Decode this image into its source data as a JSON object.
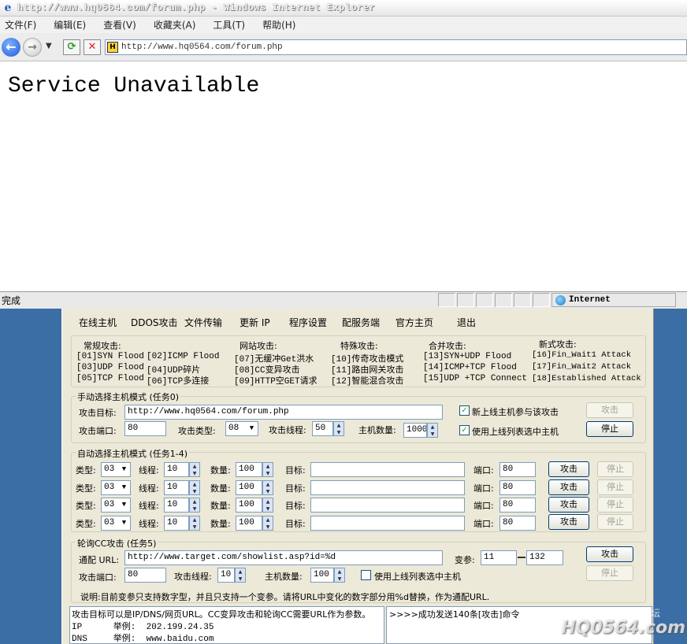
{
  "browser": {
    "title": "http://www.hq0564.com/forum.php - Windows Internet Explorer",
    "menu": [
      "文件(F)",
      "编辑(E)",
      "查看(V)",
      "收藏夹(A)",
      "工具(T)",
      "帮助(H)"
    ],
    "address": "http://www.hq0564.com/forum.php",
    "page_heading": "Service Unavailable",
    "status": "完成",
    "zone": "Internet"
  },
  "app": {
    "toolbar": [
      "在线主机",
      "DDOS攻击",
      "文件传输",
      "更新 IP",
      "程序设置",
      "配服务端",
      "官方主页",
      "退出"
    ],
    "attack_types": {
      "headers": [
        "常规攻击:",
        "网站攻击:",
        "特殊攻击:",
        "合并攻击:",
        "新式攻击:"
      ],
      "col1": [
        "[01]SYN Flood",
        "[03]UDP Flood",
        "[05]TCP Flood"
      ],
      "col2": [
        "[02]ICMP Flood",
        "[04]UDP碎片",
        "[06]TCP多连接"
      ],
      "col3": [
        "[07]无缓冲Get洪水",
        "[08]CC变异攻击",
        "[09]HTTP空GET请求"
      ],
      "col4": [
        "[10]传奇攻击模式",
        "[11]路由网关攻击",
        "[12]智能混合攻击"
      ],
      "col5": [
        "[13]SYN+UDP Flood",
        "[14]ICMP+TCP Flood",
        "[15]UDP +TCP Connect"
      ],
      "col6": [
        "[16]Fin_Wait1 Attack",
        "[17]Fin_Wait2 Attack",
        "[18]Established Attack"
      ]
    },
    "manual": {
      "title": "手动选择主机模式 (任务0)",
      "target_label": "攻击目标:",
      "target_value": "http://www.hq0564.com/forum.php",
      "port_label": "攻击端口:",
      "port_value": "80",
      "type_label": "攻击类型:",
      "type_value": "08",
      "threads_label": "攻击线程:",
      "threads_value": "50",
      "hosts_label": "主机数量:",
      "hosts_value": "1000",
      "chk_new": "新上线主机参与该攻击",
      "chk_list": "使用上线列表选中主机",
      "btn_attack": "攻击",
      "btn_stop": "停止"
    },
    "auto": {
      "title": "自动选择主机模式 (任务1-4)",
      "type_label": "类型:",
      "threads_label": "线程:",
      "count_label": "数量:",
      "target_label": "目标:",
      "port_label": "端口:",
      "btn_attack": "攻击",
      "btn_stop": "停止",
      "rows": [
        {
          "type": "03",
          "threads": "10",
          "count": "100",
          "target": "",
          "port": "80"
        },
        {
          "type": "03",
          "threads": "10",
          "count": "100",
          "target": "",
          "port": "80"
        },
        {
          "type": "03",
          "threads": "10",
          "count": "100",
          "target": "",
          "port": "80"
        },
        {
          "type": "03",
          "threads": "10",
          "count": "100",
          "target": "",
          "port": "80"
        }
      ]
    },
    "poll": {
      "title": "轮询CC攻击 (任务5)",
      "url_label": "通配 URL:",
      "url_value": "http://www.target.com/showlist.asp?id=%d",
      "var_label": "变参:",
      "var_from": "11",
      "var_to": "132",
      "port_label": "攻击端口:",
      "port_value": "80",
      "threads_label": "攻击线程:",
      "threads_value": "10",
      "hosts_label": "主机数量:",
      "hosts_value": "100",
      "chk_list": "使用上线列表选中主机",
      "btn_attack": "攻击",
      "btn_stop": "停止",
      "note": "说明:目前变参只支持数字型，并且只支持一个变参。请将URL中变化的数字部分用%d替换，作为通配URL."
    },
    "log_left": [
      "攻击目标可以是IP/DNS/网页URL。CC变异攻击和轮询CC需要URL作为参数。",
      "IP      举例:  202.199.24.35",
      "DNS     举例:  www.baidu.com"
    ],
    "log_right": ">>>>成功发送140条[攻击]命令"
  },
  "watermark": {
    "site": "HQ0564.com",
    "forum": "淮南论坛"
  }
}
